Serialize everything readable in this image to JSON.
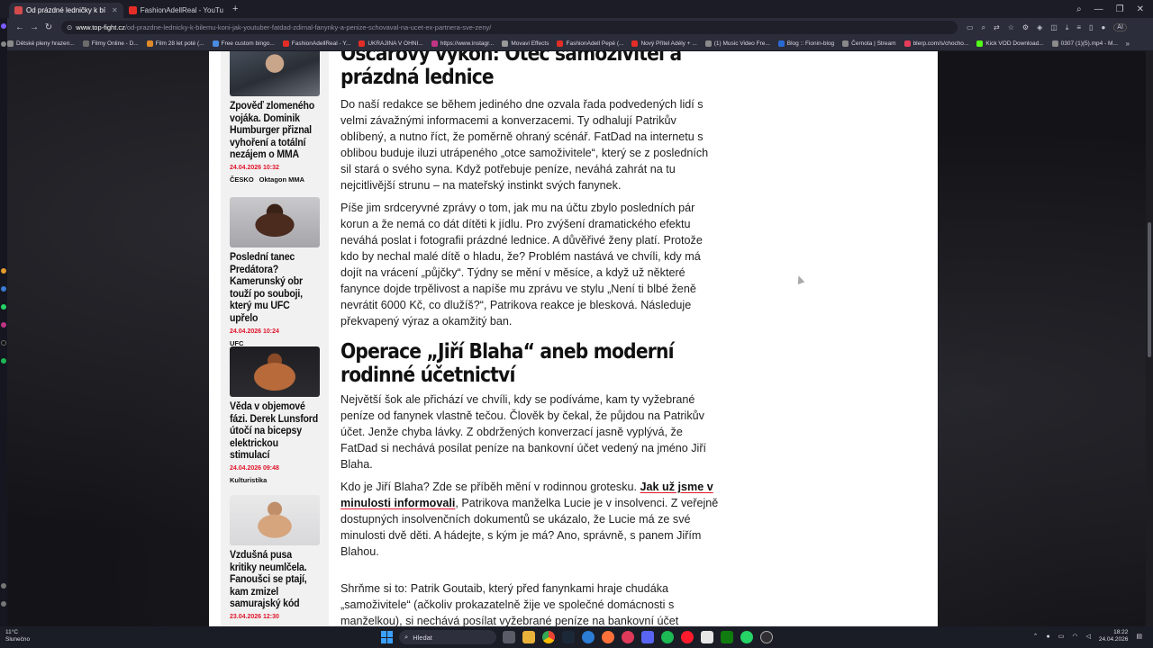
{
  "browser": {
    "tabs": [
      {
        "label": "Od prázdné ledničky k bí",
        "color": "#d44b4b",
        "active": true
      },
      {
        "label": "FashionAdellReal - YouTu",
        "color": "#e52d27",
        "active": false
      }
    ],
    "url_host": "www.top-fight.cz",
    "url_path": "/od-prazdne-lednicky-k-bilemu-koni-jak-youtuber-fatdad-zdimal-fanynky-a-penize-schovaval-na-ucet-ex-partnera-sve-zeny/",
    "ai_label": "AI",
    "bookmarks": [
      {
        "label": "Dětské pleny hrazen...",
        "color": "#8a8a8a"
      },
      {
        "label": "Filmy Online - D...",
        "color": "#6c6c6c"
      },
      {
        "label": "Film 28 let poté (...",
        "color": "#e08a2a"
      },
      {
        "label": "Free custom bingo...",
        "color": "#4b8be0"
      },
      {
        "label": "FashionAdellReal - Y...",
        "color": "#e52d27"
      },
      {
        "label": "UKRAJINA V OHNI...",
        "color": "#e52d27"
      },
      {
        "label": "https://www.instagr...",
        "color": "#c13584"
      },
      {
        "label": "Movavi Effects",
        "color": "#999999"
      },
      {
        "label": "FashionAdell Pepé (...",
        "color": "#e52d27"
      },
      {
        "label": "Nový Přítel Adély + ...",
        "color": "#e52d27"
      },
      {
        "label": "(1) Music Video Fre...",
        "color": "#8a8a8a"
      },
      {
        "label": "Blog :: Fionin-blog",
        "color": "#2a6ad4"
      },
      {
        "label": "Černota | Stream",
        "color": "#888888"
      },
      {
        "label": "blerp.com/s/chocho...",
        "color": "#e53d5a"
      },
      {
        "label": "Kick VOD Download...",
        "color": "#53fc18"
      },
      {
        "label": "0307 (1)(5).mp4 - M...",
        "color": "#8a8a8a"
      }
    ],
    "bookmarks_more": "»"
  },
  "sidebar": {
    "items": [
      {
        "title": "Zpověď zlomeného vojáka. Dominik Humburger přiznal vyhoření a totální nezájem o MMA",
        "date": "24.04.2026 10:32",
        "tags": [
          "ČESKO",
          "Oktagon MMA"
        ]
      },
      {
        "title": "Poslední tanec Predátora? Kamerunský obr touží po souboji, který mu UFC upřelo",
        "date": "24.04.2026 10:24",
        "tags": [
          "UFC"
        ]
      },
      {
        "title": "Věda v objemové fázi. Derek Lunsford útočí na bicepsy elektrickou stimulací",
        "date": "24.04.2026 09:48",
        "tags": [
          "Kulturistika"
        ]
      },
      {
        "title": "Vzdušná pusa kritiky neumlčela. Fanoušci se ptají, kam zmizel samurajský kód",
        "date": "23.04.2026 12:30",
        "tags": []
      }
    ]
  },
  "article": {
    "heading1": "Oscarový výkon: Otec samoživitel a prázdná lednice",
    "p1": "Do naší redakce se během jediného dne ozvala řada podvedených lidí s velmi závažnými informacemi a konverzacemi. Ty odhalují Patrikův oblíbený, a nutno říct, že poměrně ohraný scénář. FatDad na internetu s oblibou buduje iluzi utrápeného „otce samoživitele“, který se z posledních sil stará o svého syna. Když potřebuje peníze, neváhá zahrát na tu nejcitlivější strunu – na mateřský instinkt svých fanynek.",
    "p2": "Píše jim srdceryvné zprávy o tom, jak mu na účtu zbylo posledních pár korun a že nemá co dát dítěti k jídlu. Pro zvýšení dramatického efektu neváhá poslat i fotografii prázdné lednice. A důvěřivé ženy platí. Protože kdo by nechal malé dítě o hladu, že? Problém nastává ve chvíli, kdy má dojít na vrácení „půjčky“. Týdny se mění v měsíce, a když už některé fanynce dojde trpělivost a napíše mu zprávu ve stylu „Není ti blbé ženě nevrátit 6000 Kč, co dlužíš?“, Patrikova reakce je blesková. Následuje překvapený výraz a okamžitý ban.",
    "heading2": "Operace „Jiří Blaha“ aneb moderní rodinné účetnictví",
    "p3": "Největší šok ale přichází ve chvíli, kdy se podíváme, kam ty vyžebrané peníze od fanynek vlastně tečou. Člověk by čekal, že půjdou na Patrikův účet. Jenže chyba lávky. Z obdržených konverzací jasně vyplývá, že FatDad si nechává posílat peníze na bankovní účet vedený na jméno Jiří Blaha.",
    "p4_before": "Kdo je Jiří Blaha? Zde se příběh mění v rodinnou grotesku. ",
    "p4_link": "Jak už jsme v minulosti informovali",
    "p4_after": ", Patrikova manželka Lucie je v insolvenci. Z veřejně dostupných insolvenčních dokumentů se ukázalo, že Lucie má ze své minulosti dvě děti. A hádejte, s kým je má? Ano, správně, s panem Jiřím Blahou.",
    "p5": "Shrňme si to: Patrik Goutaib, který před fanynkami hraje chudáka „samoživitele“ (ačkoliv prokazatelně žije ve společné domácnosti s manželkou), si nechává posílat vyžebrané peníze na bankovní účet"
  },
  "taskbar": {
    "weather_temp": "11°C",
    "weather_text": "Slunečno",
    "search_placeholder": "Hledat",
    "time": "18:22",
    "date": "24.04.2026"
  }
}
